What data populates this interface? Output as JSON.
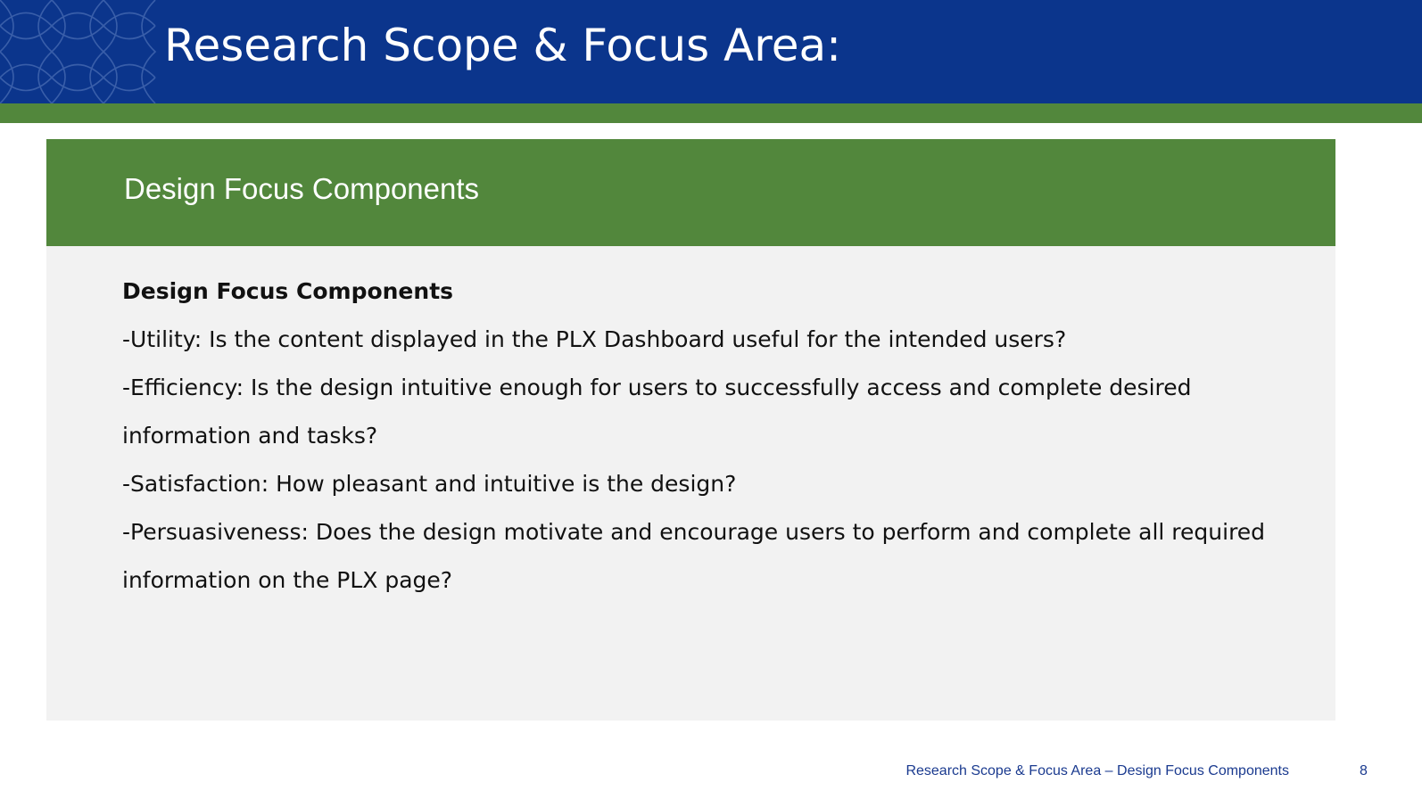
{
  "header": {
    "title": "Research Scope & Focus Area:"
  },
  "panel": {
    "title": "Design Focus Components",
    "body_heading": "Design Focus Components",
    "items": [
      "-Utility: Is the content displayed in the PLX Dashboard useful for the intended users?",
      "-Efficiency: Is the design intuitive enough for users to successfully access and complete desired information and tasks?",
      "-Satisfaction: How pleasant and intuitive is the design?",
      "-Persuasiveness: Does the design motivate and encourage users to perform and complete all required information on the PLX page?"
    ]
  },
  "footer": {
    "label": "Research Scope & Focus Area – Design Focus Components",
    "page_number": "8"
  },
  "colors": {
    "header_blue": "#0b358c",
    "accent_green": "#52873c",
    "panel_gray": "#f2f2f2",
    "footer_text": "#1a3a8f"
  },
  "icons": {
    "header_pattern": "floral-lattice-pattern-icon"
  }
}
